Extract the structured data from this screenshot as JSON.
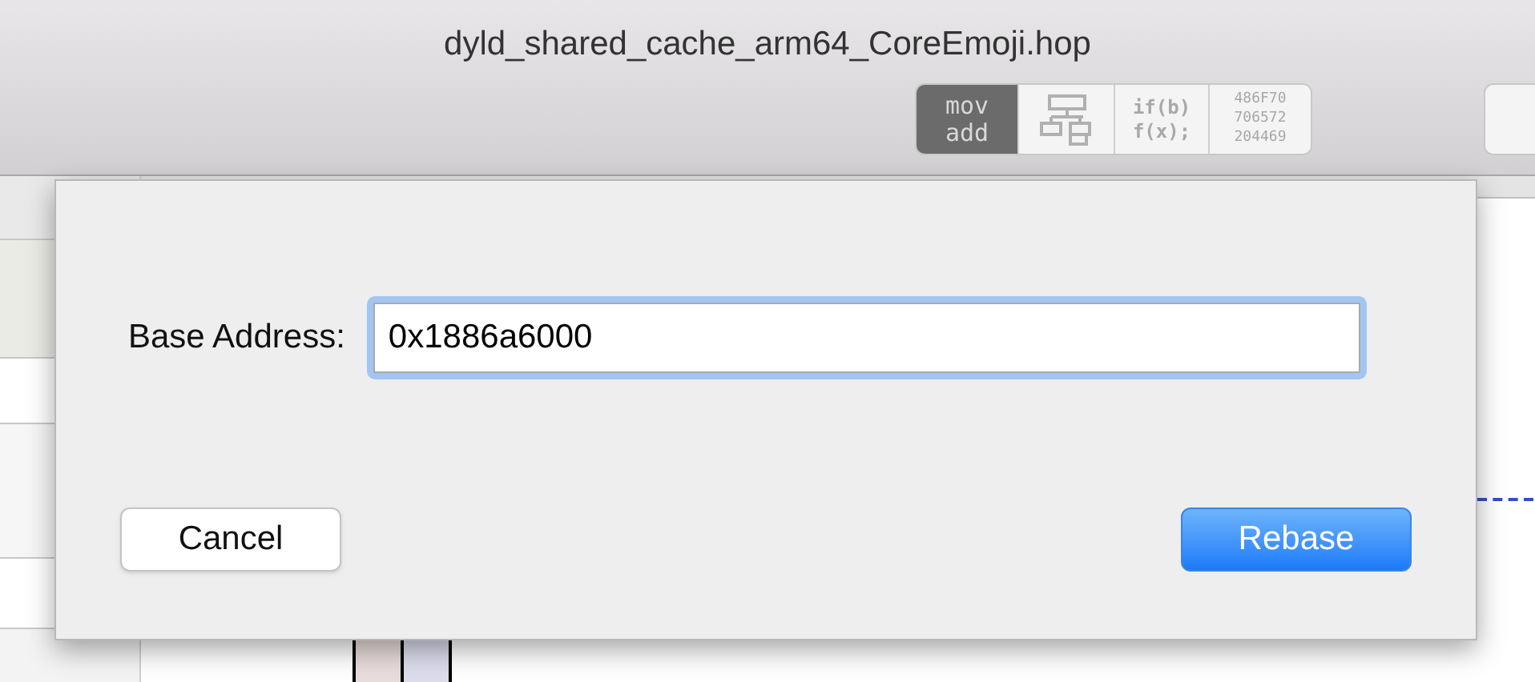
{
  "window": {
    "title": "dyld_shared_cache_arm64_CoreEmoji.hop"
  },
  "view_modes": [
    {
      "kind": "text",
      "lines": [
        "mov",
        "add"
      ],
      "selected": true
    },
    {
      "kind": "graph",
      "selected": false
    },
    {
      "kind": "text",
      "lines": [
        "if(b)",
        "f(x);"
      ],
      "selected": false
    },
    {
      "kind": "hex",
      "lines": [
        "486F70",
        "706572",
        "204469"
      ],
      "selected": false
    }
  ],
  "dialog": {
    "field_label": "Base Address:",
    "field_value": "0x1886a6000",
    "buttons": [
      {
        "label": "Cancel",
        "kind": "normal"
      },
      {
        "label": "Rebase",
        "kind": "default"
      }
    ]
  }
}
